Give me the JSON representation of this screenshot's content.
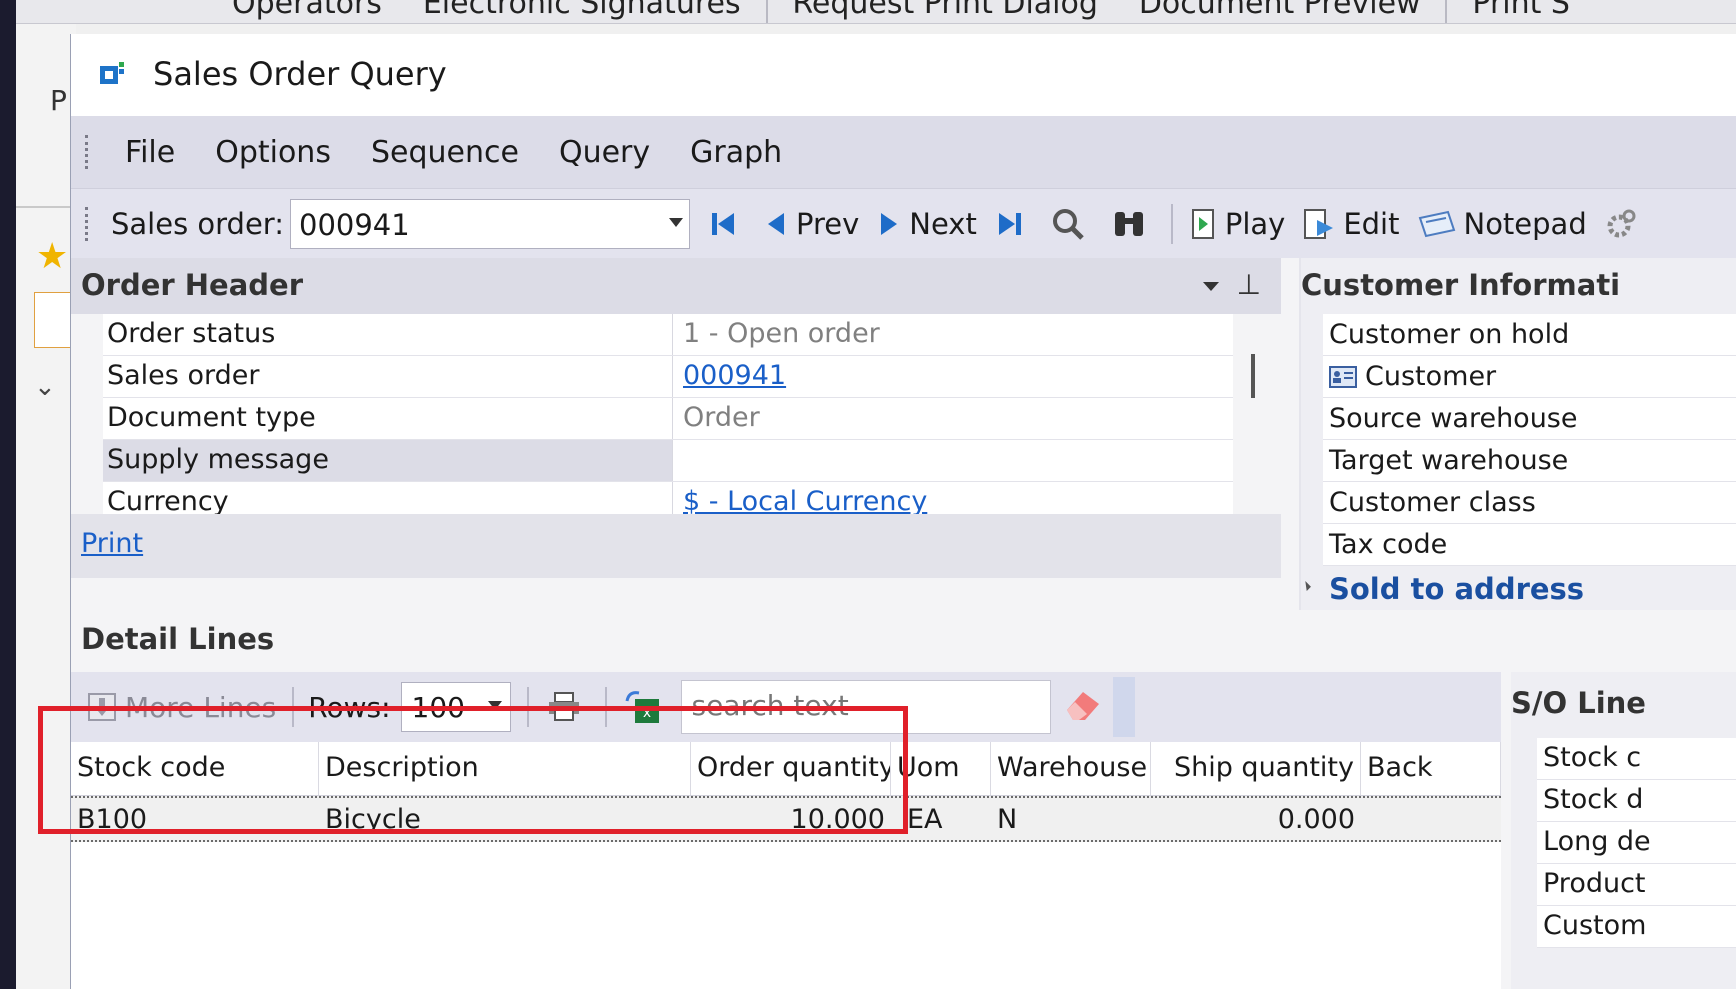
{
  "background_app": {
    "top_items": [
      "Operators",
      "Electronic Signatures",
      "Request Print Dialog",
      "Document Preview",
      "Print S"
    ],
    "left_letter": "P"
  },
  "window": {
    "title": "Sales Order Query",
    "menu": [
      "File",
      "Options",
      "Sequence",
      "Query",
      "Graph"
    ],
    "toolbar": {
      "sales_order_label": "Sales order:",
      "sales_order_value": "000941",
      "prev_label": "Prev",
      "next_label": "Next",
      "play_label": "Play",
      "edit_label": "Edit",
      "notepad_label": "Notepad"
    }
  },
  "order_header": {
    "title": "Order Header",
    "rows": [
      {
        "key": "Order status",
        "value": "1 - Open order"
      },
      {
        "key": "Sales order",
        "value": "000941"
      },
      {
        "key": "Document type",
        "value": "Order"
      },
      {
        "key": "Supply message",
        "value": ""
      },
      {
        "key": "Currency",
        "value": "$ - Local Currency"
      }
    ],
    "print_link": "Print"
  },
  "customer_info": {
    "title": "Customer Informati",
    "rows": [
      "Customer on hold",
      "Customer",
      "Source warehouse",
      "Target warehouse",
      "Customer class",
      "Tax code"
    ],
    "section": "Sold to address"
  },
  "detail_lines": {
    "title": "Detail Lines",
    "more_lines_label": "More Lines",
    "rows_label": "Rows:",
    "rows_value": "100",
    "search_placeholder": "search text",
    "columns": [
      "Stock code",
      "Description",
      "Order quantity",
      "Uom",
      "Warehouse",
      "Ship quantity",
      "Back"
    ],
    "data": [
      {
        "stock_code": "B100",
        "description": "Bicycle",
        "order_quantity": "10.000",
        "uom": "EA",
        "warehouse": "N",
        "ship_quantity": "0.000",
        "back": ""
      }
    ]
  },
  "so_lines": {
    "title": "S/O Line",
    "rows": [
      "Stock c",
      "Stock d",
      "Long de",
      "Product",
      "Custom"
    ]
  },
  "colors": {
    "highlight": "#e0202a",
    "link": "#1a5fc8",
    "section_blue": "#1a4fa0"
  }
}
